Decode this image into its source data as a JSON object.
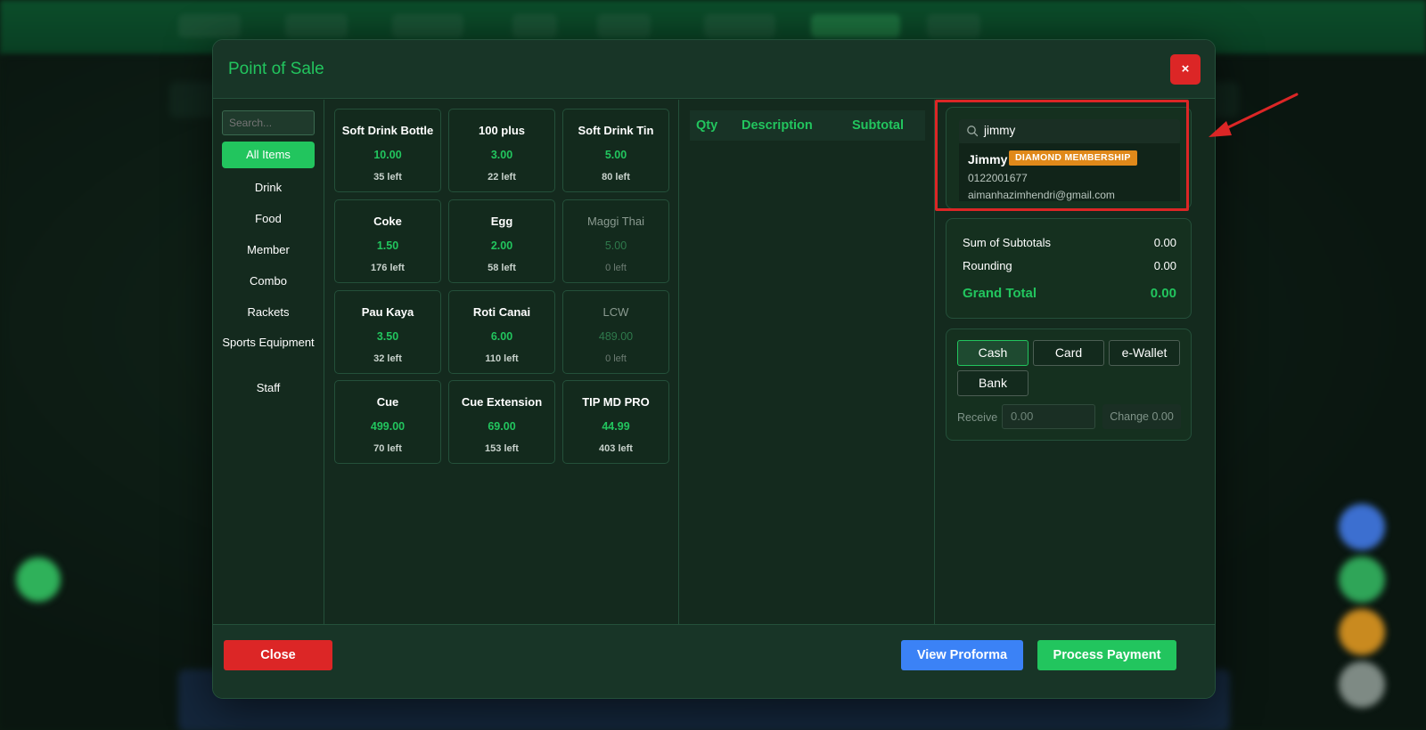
{
  "modal": {
    "title": "Point of Sale",
    "close_x": "×"
  },
  "categories": {
    "search_placeholder": "Search...",
    "items": [
      "All Items",
      "Drink",
      "Food",
      "Member",
      "Combo",
      "Rackets",
      "Sports Equipment",
      "Staff"
    ]
  },
  "products": [
    {
      "name": "Soft Drink Bottle",
      "price": "10.00",
      "stock": "35 left"
    },
    {
      "name": "100 plus",
      "price": "3.00",
      "stock": "22 left"
    },
    {
      "name": "Soft Drink Tin",
      "price": "5.00",
      "stock": "80 left"
    },
    {
      "name": "Coke",
      "price": "1.50",
      "stock": "176 left"
    },
    {
      "name": "Egg",
      "price": "2.00",
      "stock": "58 left"
    },
    {
      "name": "Maggi Thai",
      "price": "5.00",
      "stock": "0 left"
    },
    {
      "name": "Pau Kaya",
      "price": "3.50",
      "stock": "32 left"
    },
    {
      "name": "Roti Canai",
      "price": "6.00",
      "stock": "110 left"
    },
    {
      "name": "LCW",
      "price": "489.00",
      "stock": "0 left"
    },
    {
      "name": "Cue",
      "price": "499.00",
      "stock": "70 left"
    },
    {
      "name": "Cue Extension",
      "price": "69.00",
      "stock": "153 left"
    },
    {
      "name": "TIP MD PRO",
      "price": "44.99",
      "stock": "403 left"
    }
  ],
  "cart": {
    "col_qty": "Qty",
    "col_description": "Description",
    "col_subtotal": "Subtotal"
  },
  "customer": {
    "query": "jimmy",
    "name": "Jimmy",
    "membership": "DIAMOND MEMBERSHIP",
    "phone": "0122001677",
    "email": "aimanhazimhendri@gmail.com"
  },
  "totals": {
    "sum_label": "Sum of Subtotals",
    "sum_value": "0.00",
    "rounding_label": "Rounding",
    "rounding_value": "0.00",
    "grand_label": "Grand Total",
    "grand_value": "0.00"
  },
  "payment": {
    "methods": [
      "Cash",
      "Card",
      "e-Wallet",
      "Bank"
    ],
    "selected": "Cash",
    "receive_label": "Receive",
    "receive_placeholder": "0.00",
    "change_text": "Change 0.00"
  },
  "footer": {
    "close": "Close",
    "view_proforma": "View Proforma",
    "process_payment": "Process Payment"
  },
  "colors": {
    "accent": "#22c55e",
    "danger": "#dc2626",
    "info": "#3b82f6",
    "badge": "#e0891a"
  }
}
